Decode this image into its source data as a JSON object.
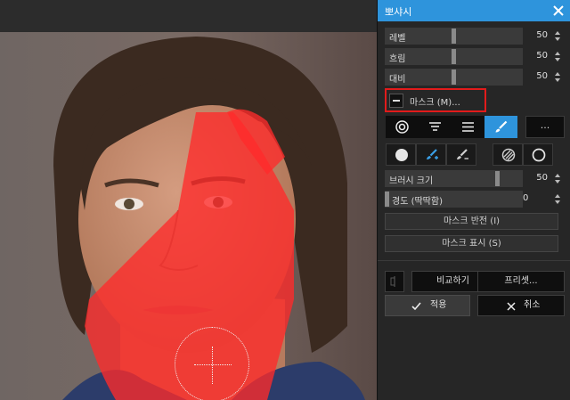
{
  "panel": {
    "title": "뽀샤시",
    "close_icon": "close-icon",
    "sliders": [
      {
        "label": "레벨",
        "value": "50",
        "level": 0.5
      },
      {
        "label": "흐림",
        "value": "50",
        "level": 0.5
      },
      {
        "label": "대비",
        "value": "50",
        "level": 0.5
      }
    ],
    "mask_button": {
      "label": "마스크 (M)...",
      "icon": "minus-icon"
    },
    "mask_tools": [
      "radial-gradient-icon",
      "linear-gradient-icon",
      "lines-icon",
      "brush-icon"
    ],
    "more_label": "...",
    "brush_tools": [
      "filled-circle-icon",
      "brush-plus-icon",
      "brush-minus-icon",
      "hatched-circle-icon",
      "empty-circle-icon"
    ],
    "brush_size": {
      "label": "브러시 크기",
      "value": "50",
      "level": 0.85
    },
    "hardness": {
      "label": "경도 (딱딱함)",
      "value": "0",
      "level": 0.0
    },
    "invert_mask_label": "마스크 반전 (I)",
    "show_mask_label": "마스크 표시 (S)",
    "compare_label": "비교하기",
    "preset_label": "프리셋...",
    "apply_label": "적용",
    "cancel_label": "취소"
  },
  "colors": {
    "accent": "#2e94dc",
    "highlight_border": "#e21b1b",
    "mask_overlay": "#ff2a2a"
  }
}
